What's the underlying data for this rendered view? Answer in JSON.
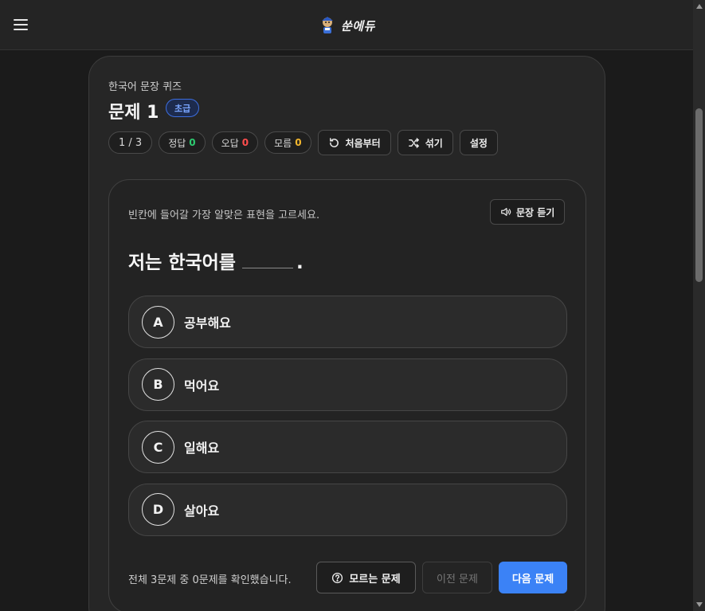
{
  "header": {
    "brand_name": "쑨에듀",
    "menu_icon": "hamburger-menu-icon",
    "logo_icon": "mascot-logo-icon"
  },
  "quiz": {
    "kicker": "한국어 문장 퀴즈",
    "title": "문제 1",
    "level": "초급",
    "progress": "1 / 3",
    "stats": {
      "correct_label": "정답",
      "correct_count": "0",
      "wrong_label": "오답",
      "wrong_count": "0",
      "unknown_label": "모름",
      "unknown_count": "0"
    },
    "tools": {
      "restart_label": "처음부터",
      "shuffle_label": "섞기",
      "settings_label": "설정"
    }
  },
  "question": {
    "instruction": "빈칸에 들어갈 가장 알맞은 표현을 고르세요.",
    "listen_label": "문장 듣기",
    "sentence_before": "저는 한국어를",
    "sentence_after": ".",
    "options": [
      {
        "letter": "A",
        "text": "공부해요"
      },
      {
        "letter": "B",
        "text": "먹어요"
      },
      {
        "letter": "C",
        "text": "일해요"
      },
      {
        "letter": "D",
        "text": "살아요"
      }
    ]
  },
  "footer": {
    "note": "전체 3문제 중 0문제를 확인했습니다.",
    "unknown_button": "모르는 문제",
    "prev_button": "이전 문제",
    "next_button": "다음 문제"
  },
  "colors": {
    "accent": "#3b82f6",
    "correct": "#2ecc71",
    "wrong": "#ff4d4d",
    "unknown": "#f5b82e"
  }
}
